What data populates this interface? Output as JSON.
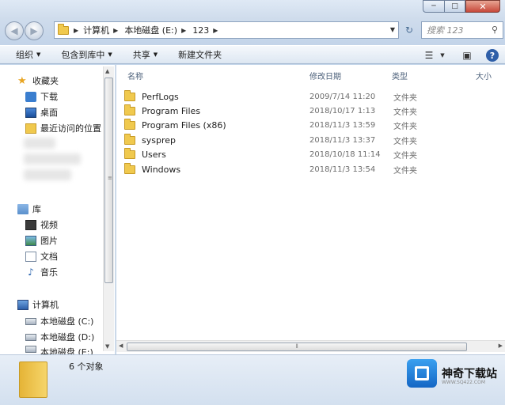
{
  "window": {
    "buttons": [
      "─",
      "□",
      "✕"
    ]
  },
  "address": {
    "segments": [
      "计算机",
      "本地磁盘 (E:)",
      "123"
    ],
    "search_placeholder": "搜索 123"
  },
  "toolbar": {
    "organize": "组织",
    "include_in_library": "包含到库中",
    "share": "共享",
    "new_folder": "新建文件夹"
  },
  "sidebar": {
    "favorites": "收藏夹",
    "downloads": "下载",
    "desktop": "桌面",
    "recent": "最近访问的位置",
    "libraries": "库",
    "videos": "视频",
    "pictures": "图片",
    "documents": "文档",
    "music": "音乐",
    "computer": "计算机",
    "drive_c": "本地磁盘 (C:)",
    "drive_d": "本地磁盘 (D:)",
    "drive_e": "本地磁盘 (E:)"
  },
  "columns": {
    "name": "名称",
    "date": "修改日期",
    "type": "类型",
    "size": "大小"
  },
  "files": [
    {
      "name": "PerfLogs",
      "date": "2009/7/14 11:20",
      "type": "文件夹"
    },
    {
      "name": "Program Files",
      "date": "2018/10/17 1:13",
      "type": "文件夹"
    },
    {
      "name": "Program Files (x86)",
      "date": "2018/11/3 13:59",
      "type": "文件夹"
    },
    {
      "name": "sysprep",
      "date": "2018/11/3 13:37",
      "type": "文件夹"
    },
    {
      "name": "Users",
      "date": "2018/10/18 11:14",
      "type": "文件夹"
    },
    {
      "name": "Windows",
      "date": "2018/11/3 13:54",
      "type": "文件夹"
    }
  ],
  "status": {
    "count": "6 个对象"
  },
  "watermark": {
    "title": "神奇下载站",
    "url": "WWW.SQ422.COM"
  }
}
